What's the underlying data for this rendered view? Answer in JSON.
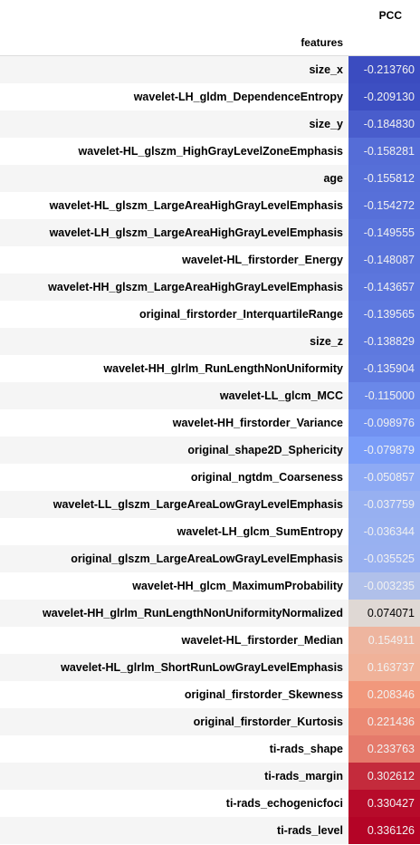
{
  "table": {
    "column_header": "PCC",
    "index_header": "features"
  },
  "chart_data": {
    "type": "table",
    "columns": [
      "PCC"
    ],
    "index_name": "features",
    "colormap": "coolwarm",
    "rows": [
      {
        "feature": "size_x",
        "value": "-0.213760"
      },
      {
        "feature": "wavelet-LH_gldm_DependenceEntropy",
        "value": "-0.209130"
      },
      {
        "feature": "size_y",
        "value": "-0.184830"
      },
      {
        "feature": "wavelet-HL_glszm_HighGrayLevelZoneEmphasis",
        "value": "-0.158281"
      },
      {
        "feature": "age",
        "value": "-0.155812"
      },
      {
        "feature": "wavelet-HL_glszm_LargeAreaHighGrayLevelEmphasis",
        "value": "-0.154272"
      },
      {
        "feature": "wavelet-LH_glszm_LargeAreaHighGrayLevelEmphasis",
        "value": "-0.149555"
      },
      {
        "feature": "wavelet-HL_firstorder_Energy",
        "value": "-0.148087"
      },
      {
        "feature": "wavelet-HH_glszm_LargeAreaHighGrayLevelEmphasis",
        "value": "-0.143657"
      },
      {
        "feature": "original_firstorder_InterquartileRange",
        "value": "-0.139565"
      },
      {
        "feature": "size_z",
        "value": "-0.138829"
      },
      {
        "feature": "wavelet-HH_glrlm_RunLengthNonUniformity",
        "value": "-0.135904"
      },
      {
        "feature": "wavelet-LL_glcm_MCC",
        "value": "-0.115000"
      },
      {
        "feature": "wavelet-HH_firstorder_Variance",
        "value": "-0.098976"
      },
      {
        "feature": "original_shape2D_Sphericity",
        "value": "-0.079879"
      },
      {
        "feature": "original_ngtdm_Coarseness",
        "value": "-0.050857"
      },
      {
        "feature": "wavelet-LL_glszm_LargeAreaLowGrayLevelEmphasis",
        "value": "-0.037759"
      },
      {
        "feature": "wavelet-LH_glcm_SumEntropy",
        "value": "-0.036344"
      },
      {
        "feature": "original_glszm_LargeAreaLowGrayLevelEmphasis",
        "value": "-0.035525"
      },
      {
        "feature": "wavelet-HH_glcm_MaximumProbability",
        "value": "-0.003235"
      },
      {
        "feature": "wavelet-HH_glrlm_RunLengthNonUniformityNormalized",
        "value": "0.074071"
      },
      {
        "feature": "wavelet-HL_firstorder_Median",
        "value": "0.154911"
      },
      {
        "feature": "wavelet-HL_glrlm_ShortRunLowGrayLevelEmphasis",
        "value": "0.163737"
      },
      {
        "feature": "original_firstorder_Skewness",
        "value": "0.208346"
      },
      {
        "feature": "original_firstorder_Kurtosis",
        "value": "0.221436"
      },
      {
        "feature": "ti-rads_shape",
        "value": "0.233763"
      },
      {
        "feature": "ti-rads_margin",
        "value": "0.302612"
      },
      {
        "feature": "ti-rads_echogenicfoci",
        "value": "0.330427"
      },
      {
        "feature": "ti-rads_level",
        "value": "0.336126"
      }
    ]
  }
}
